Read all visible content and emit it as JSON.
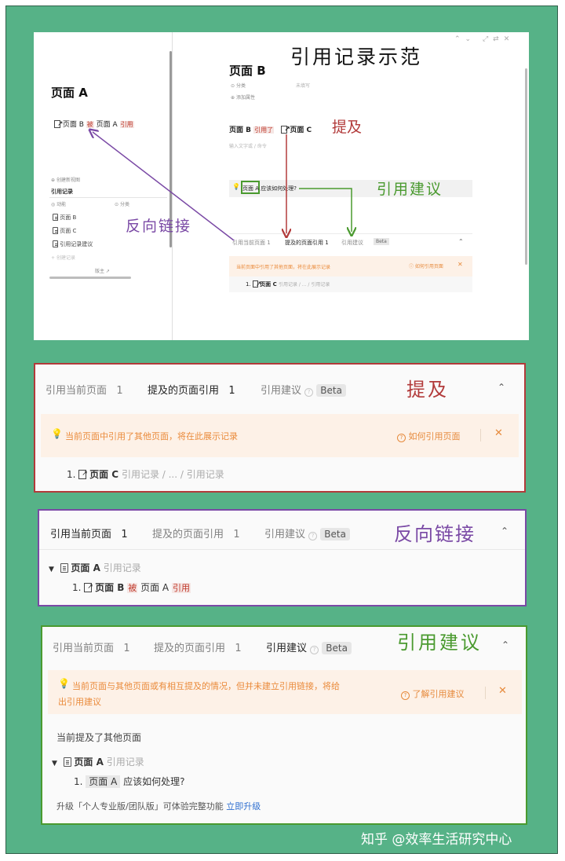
{
  "colors": {
    "green_bg": "#56b287",
    "red": "#b23a3a",
    "purple": "#7a49a5",
    "green": "#4a9a2f",
    "orange_notice": "#ea8a3a"
  },
  "screenshot": {
    "title": "引用记录示范",
    "left": {
      "page_title": "页面 A",
      "line": {
        "page_b": "页面 B",
        "bei": "被",
        "page_a": "页面 A",
        "yinyong": "引用"
      },
      "create_view": "创建新视图",
      "section": "引用记录",
      "col1": "动能",
      "col2": "分类",
      "rows": [
        "页面 B",
        "页面 C",
        "引用记录建议"
      ],
      "new_record": "创建记录",
      "footer": "版主 ↗"
    },
    "right": {
      "page_title": "页面 B",
      "prop1": "分类",
      "prop1_val": "未填写",
      "prop2": "添加属性",
      "line": {
        "page_b": "页面 B",
        "yinyongle": "引用了",
        "page_c": "页面 C"
      },
      "placeholder": "输入文字或 / 命令",
      "highlight": "页面 A",
      "highlight_text": "应该如何处理?",
      "tabs": [
        "引用当前页面 1",
        "提及的页面引用 1",
        "引用建议",
        "Beta"
      ],
      "notice": "当前页面中引用了其他页面，将在此展示记录",
      "notice_link": "如何引用页面",
      "item": "1.",
      "item_page": "页面 C",
      "item_path": "引用记录 / ... / 引用记录"
    },
    "annotations": {
      "mention": "提及",
      "backlink": "反向链接",
      "suggest": "引用建议"
    }
  },
  "panel_mention": {
    "label": "提及",
    "tab1": "引用当前页面",
    "tab1_count": "1",
    "tab2": "提及的页面引用",
    "tab2_count": "1",
    "tab3": "引用建议",
    "beta": "Beta",
    "notice": "当前页面中引用了其他页面，将在此展示记录",
    "how": "如何引用页面",
    "item_num": "1.",
    "item_page": "页面 C",
    "item_path": "引用记录 / ... / 引用记录"
  },
  "panel_backlink": {
    "label": "反向链接",
    "tab1": "引用当前页面",
    "tab1_count": "1",
    "tab2": "提及的页面引用",
    "tab2_count": "1",
    "tab3": "引用建议",
    "beta": "Beta",
    "group_page": "页面 A",
    "group_path": "引用记录",
    "item_num": "1.",
    "item_page_b": "页面 B",
    "item_bei": "被",
    "item_page_a": "页面 A",
    "item_yinyong": "引用"
  },
  "panel_suggest": {
    "label": "引用建议",
    "tab1": "引用当前页面",
    "tab1_count": "1",
    "tab2": "提及的页面引用",
    "tab2_count": "1",
    "tab3": "引用建议",
    "beta": "Beta",
    "notice_line1": "当前页面与其他页面或有相互提及的情况，但并未建立引用链接，将给",
    "notice_line2": "出引用建议",
    "how": "了解引用建议",
    "subhead": "当前提及了其他页面",
    "group_page": "页面 A",
    "group_path": "引用记录",
    "item_num": "1.",
    "item_page": "页面 A",
    "item_text": "应该如何处理?",
    "upgrade_text": "升级「个人专业版/团队版」可体验完整功能",
    "upgrade_link": "立即升级"
  },
  "watermark": "知乎 @效率生活研究中心"
}
